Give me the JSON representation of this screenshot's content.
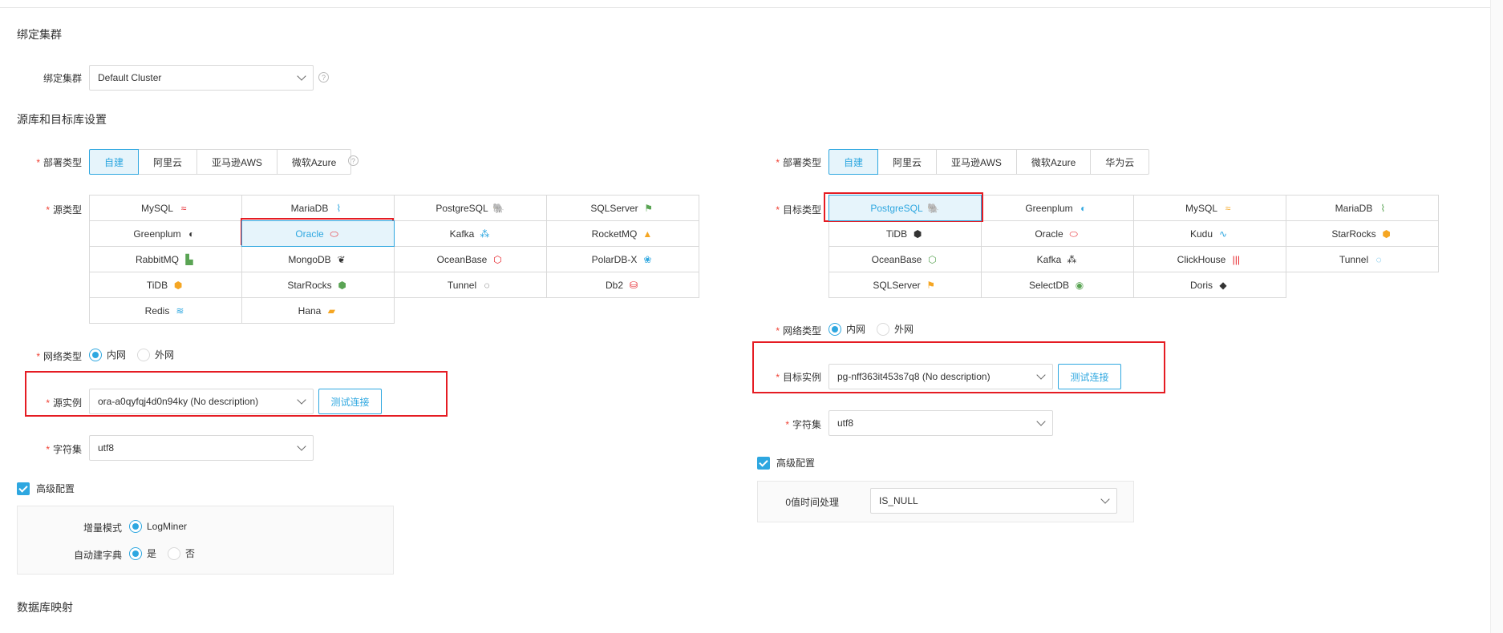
{
  "sections": {
    "bind_cluster": "绑定集群",
    "source_target": "源库和目标库设置",
    "db_mapping": "数据库映射"
  },
  "cluster": {
    "label": "绑定集群",
    "value": "Default Cluster",
    "help": "?"
  },
  "source": {
    "deploy_label": "部署类型",
    "deploy_options": [
      "自建",
      "阿里云",
      "亚马逊AWS",
      "微软Azure"
    ],
    "deploy_selected": "自建",
    "type_label": "源类型",
    "types": [
      {
        "name": "MySQL",
        "icon": "mysql-icon",
        "glyph": "≈"
      },
      {
        "name": "MariaDB",
        "icon": "mariadb-icon",
        "glyph": "⌇"
      },
      {
        "name": "PostgreSQL",
        "icon": "postgresql-icon",
        "glyph": "🐘"
      },
      {
        "name": "SQLServer",
        "icon": "sqlserver-icon",
        "glyph": "⚑"
      },
      {
        "name": "Greenplum",
        "icon": "greenplum-icon",
        "glyph": "◐"
      },
      {
        "name": "Oracle",
        "icon": "oracle-icon",
        "glyph": "⬭"
      },
      {
        "name": "Kafka",
        "icon": "kafka-icon",
        "glyph": "⁂"
      },
      {
        "name": "RocketMQ",
        "icon": "rocketmq-icon",
        "glyph": "▲"
      },
      {
        "name": "RabbitMQ",
        "icon": "rabbitmq-icon",
        "glyph": "▙"
      },
      {
        "name": "MongoDB",
        "icon": "mongodb-icon",
        "glyph": "❦"
      },
      {
        "name": "OceanBase",
        "icon": "oceanbase-icon",
        "glyph": "⬡"
      },
      {
        "name": "PolarDB-X",
        "icon": "polardb-icon",
        "glyph": "❀"
      },
      {
        "name": "TiDB",
        "icon": "tidb-icon",
        "glyph": "⬢"
      },
      {
        "name": "StarRocks",
        "icon": "starrocks-icon",
        "glyph": "⬢"
      },
      {
        "name": "Tunnel",
        "icon": "tunnel-icon",
        "glyph": "◌"
      },
      {
        "name": "Db2",
        "icon": "db2-icon",
        "glyph": "⛁"
      },
      {
        "name": "Redis",
        "icon": "redis-icon",
        "glyph": "≋"
      },
      {
        "name": "Hana",
        "icon": "hana-icon",
        "glyph": "▰"
      }
    ],
    "type_selected": "Oracle",
    "network_label": "网络类型",
    "network_options": [
      "内网",
      "外网"
    ],
    "network_selected": "内网",
    "instance_label": "源实例",
    "instance_value": "ora-a0qyfqj4d0n94ky (No description)",
    "test_button": "测试连接",
    "charset_label": "字符集",
    "charset_value": "utf8",
    "advanced_label": "高级配置",
    "incremental_label": "增量模式",
    "incremental_value": "LogMiner",
    "autodict_label": "自动建字典",
    "autodict_options": [
      "是",
      "否"
    ],
    "autodict_selected": "是"
  },
  "target": {
    "deploy_label": "部署类型",
    "deploy_options": [
      "自建",
      "阿里云",
      "亚马逊AWS",
      "微软Azure",
      "华为云"
    ],
    "deploy_selected": "自建",
    "type_label": "目标类型",
    "types": [
      {
        "name": "PostgreSQL",
        "icon": "postgresql-icon",
        "glyph": "🐘"
      },
      {
        "name": "Greenplum",
        "icon": "greenplum-icon",
        "glyph": "◐"
      },
      {
        "name": "MySQL",
        "icon": "mysql-icon",
        "glyph": "≈"
      },
      {
        "name": "MariaDB",
        "icon": "mariadb-icon",
        "glyph": "⌇"
      },
      {
        "name": "TiDB",
        "icon": "tidb-icon",
        "glyph": "⬢"
      },
      {
        "name": "Oracle",
        "icon": "oracle-icon",
        "glyph": "⬭"
      },
      {
        "name": "Kudu",
        "icon": "kudu-icon",
        "glyph": "∿"
      },
      {
        "name": "StarRocks",
        "icon": "starrocks-icon",
        "glyph": "⬢"
      },
      {
        "name": "OceanBase",
        "icon": "oceanbase-icon",
        "glyph": "⬡"
      },
      {
        "name": "Kafka",
        "icon": "kafka-icon",
        "glyph": "⁂"
      },
      {
        "name": "ClickHouse",
        "icon": "clickhouse-icon",
        "glyph": "|||"
      },
      {
        "name": "Tunnel",
        "icon": "tunnel-icon",
        "glyph": "◌"
      },
      {
        "name": "SQLServer",
        "icon": "sqlserver-icon",
        "glyph": "⚑"
      },
      {
        "name": "SelectDB",
        "icon": "selectdb-icon",
        "glyph": "◉"
      },
      {
        "name": "Doris",
        "icon": "doris-icon",
        "glyph": "◆"
      }
    ],
    "type_selected": "PostgreSQL",
    "network_label": "网络类型",
    "network_options": [
      "内网",
      "外网"
    ],
    "network_selected": "内网",
    "instance_label": "目标实例",
    "instance_value": "pg-nff363it453s7q8 (No description)",
    "test_button": "测试连接",
    "charset_label": "字符集",
    "charset_value": "utf8",
    "advanced_label": "高级配置",
    "zero_time_label": "0值时间处理",
    "zero_time_value": "IS_NULL"
  },
  "colors": {
    "accent": "#2ea7e0",
    "required": "#f04134",
    "highlight_box": "#e51c23"
  }
}
